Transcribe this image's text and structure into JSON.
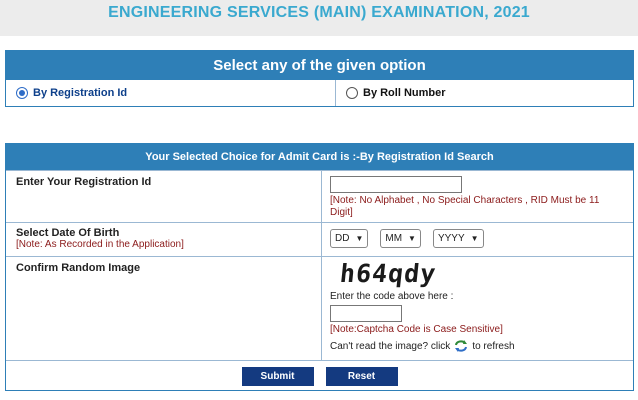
{
  "header": {
    "title": "ENGINEERING SERVICES (MAIN) EXAMINATION, 2021"
  },
  "option_box": {
    "heading": "Select any of the given option",
    "options": [
      {
        "label": "By Registration Id",
        "selected": true
      },
      {
        "label": "By Roll Number",
        "selected": false
      }
    ]
  },
  "form": {
    "heading": "Your Selected Choice for Admit Card is :-By Registration Id Search",
    "registration": {
      "label": "Enter Your Registration Id",
      "value": "",
      "note": "[Note: No Alphabet , No Special Characters , RID Must be 11 Digit]"
    },
    "dob": {
      "label": "Select Date Of Birth",
      "note": "[Note: As Recorded in the Application]",
      "day": "DD",
      "month": "MM",
      "year": "YYYY"
    },
    "captcha": {
      "label": "Confirm Random Image",
      "code": "h64qdy",
      "enter_text": "Enter the code above here :",
      "value": "",
      "note": "[Note:Captcha Code is Case Sensitive]",
      "cant_read": "Can't read the image? click",
      "refresh_text": "to refresh"
    },
    "buttons": {
      "submit": "Submit",
      "reset": "Reset"
    }
  },
  "colors": {
    "header_bar": "#2e7fb7",
    "title": "#3aa9cf",
    "button": "#143a80",
    "note": "#8b1a1a"
  }
}
